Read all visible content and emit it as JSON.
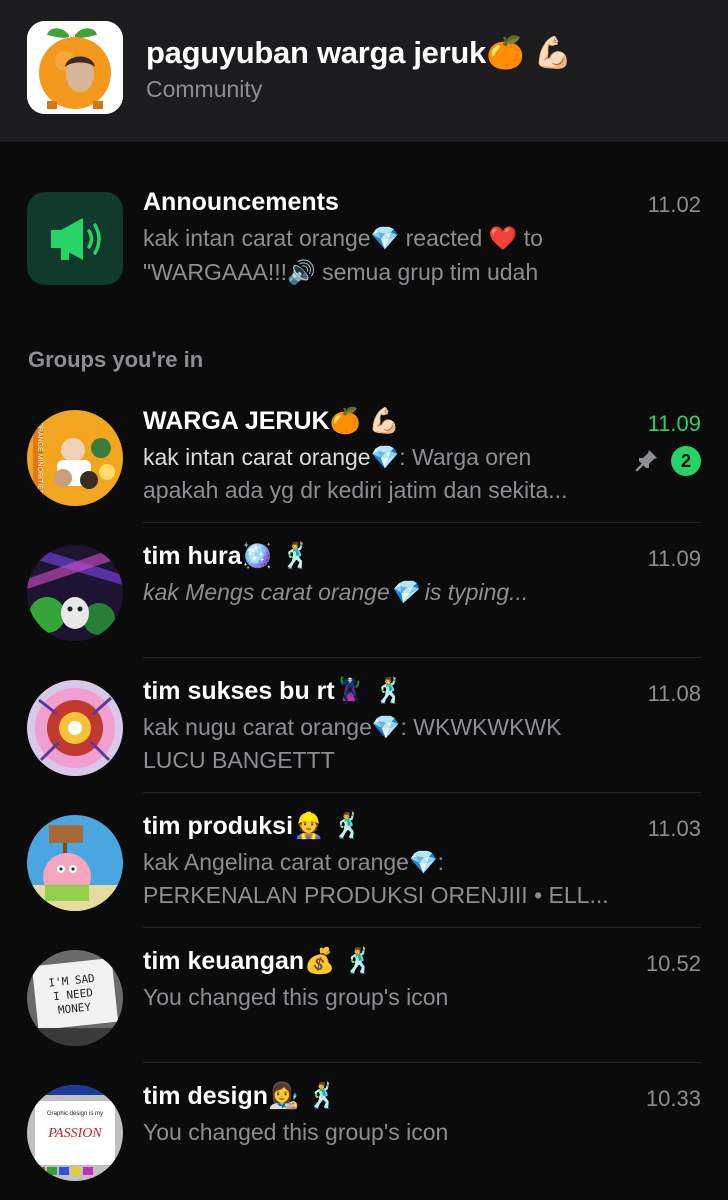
{
  "header": {
    "title": "paguyuban warga jeruk",
    "title_emoji": "🍊 💪🏻",
    "subtitle": "Community"
  },
  "announcement": {
    "name": "Announcements",
    "time": "11.02",
    "line1": "kak intan carat orange💎 reacted ❤️ to",
    "line2": "\"WARGAAA!!!🔊  semua grup tim udah"
  },
  "section_title": "Groups you're in",
  "groups": [
    {
      "name": "WARGA JERUK",
      "name_emoji": "🍊 💪🏻",
      "time": "11.09",
      "time_highlight": true,
      "sender": "kak intan carat orange💎",
      "line1_rest": ": Warga oren",
      "line2": "apakah ada yg dr kediri jatim dan sekita...",
      "pinned": true,
      "unread": "2"
    },
    {
      "name": "tim hura",
      "name_emoji": "🪩 🕺",
      "time": "11.09",
      "line1": "kak Mengs carat orange💎 is typing...",
      "line2": ""
    },
    {
      "name": "tim sukses bu rt",
      "name_emoji": "🦹 🕺",
      "time": "11.08",
      "line1": "kak nugu carat orange💎: WKWKWKWK",
      "line2": "LUCU BANGETTT"
    },
    {
      "name": "tim produksi",
      "name_emoji": "👷 🕺",
      "time": "11.03",
      "line1": "kak Angelina carat orange💎:",
      "line2": "PERKENALAN PRODUKSI ORENJIII •  ELL..."
    },
    {
      "name": "tim keuangan",
      "name_emoji": "💰 🕺",
      "time": "10.52",
      "line1": "You changed this group's icon",
      "line2": ""
    },
    {
      "name": "tim design",
      "name_emoji": "👩‍🎨 🕺",
      "time": "10.33",
      "line1": "You changed this group's icon",
      "line2": ""
    }
  ],
  "avatar_texts": {
    "keuangan_sign": [
      "I'M SAD",
      "I NEED",
      "MONEY"
    ],
    "design_sign_top": "Graphic design is my",
    "design_sign_main": "PASSION",
    "warga_side_text": "ORANGE MINORITIES"
  },
  "colors": {
    "background": "#0b0b0b",
    "header_bg": "#1c1c1e",
    "accent_green": "#25d366",
    "secondary_text": "#8d8d93"
  }
}
